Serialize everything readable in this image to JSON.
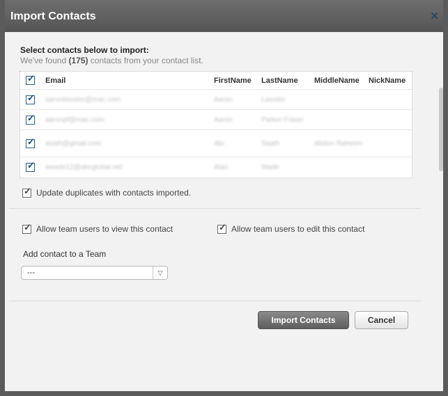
{
  "dialog": {
    "title": "Import Contacts",
    "close_glyph": "✕"
  },
  "intro": {
    "heading": "Select contacts below to import:",
    "sub_prefix": "We've found ",
    "count": "(175)",
    "sub_suffix": " contacts from your contact list."
  },
  "table": {
    "columns": [
      "Email",
      "FirstName",
      "LastName",
      "MiddleName",
      "NickName"
    ],
    "rows": [
      {
        "email": "aaronlassiter@mac.com",
        "first": "Aaron",
        "last": "Lassiter",
        "middle": "",
        "nick": ""
      },
      {
        "email": "aaronpf@mac.com",
        "first": "Aaron",
        "last": "Parker Fraser",
        "middle": "",
        "nick": ""
      },
      {
        "email": "asath@gmail.com",
        "first": "Abi",
        "last": "Saath",
        "middle": "Abdun Raheem",
        "nick": ""
      },
      {
        "email": "awade12@abcglobal.net",
        "first": "Alan",
        "last": "Wade",
        "middle": "",
        "nick": ""
      }
    ]
  },
  "options": {
    "update_duplicates": "Update duplicates with contacts imported.",
    "allow_view": "Allow team users to view this contact",
    "allow_edit": "Allow team users to edit this contact"
  },
  "team": {
    "label": "Add contact to a Team",
    "selected": "---"
  },
  "buttons": {
    "import": "Import Contacts",
    "cancel": "Cancel"
  },
  "icons": {
    "checkmark": "✓",
    "dropdown": "▽"
  },
  "colors": {
    "title_bar": "#5b5b5b",
    "checkbox_tick": "#1e4b78",
    "primary_button": "#6e6e6e"
  }
}
